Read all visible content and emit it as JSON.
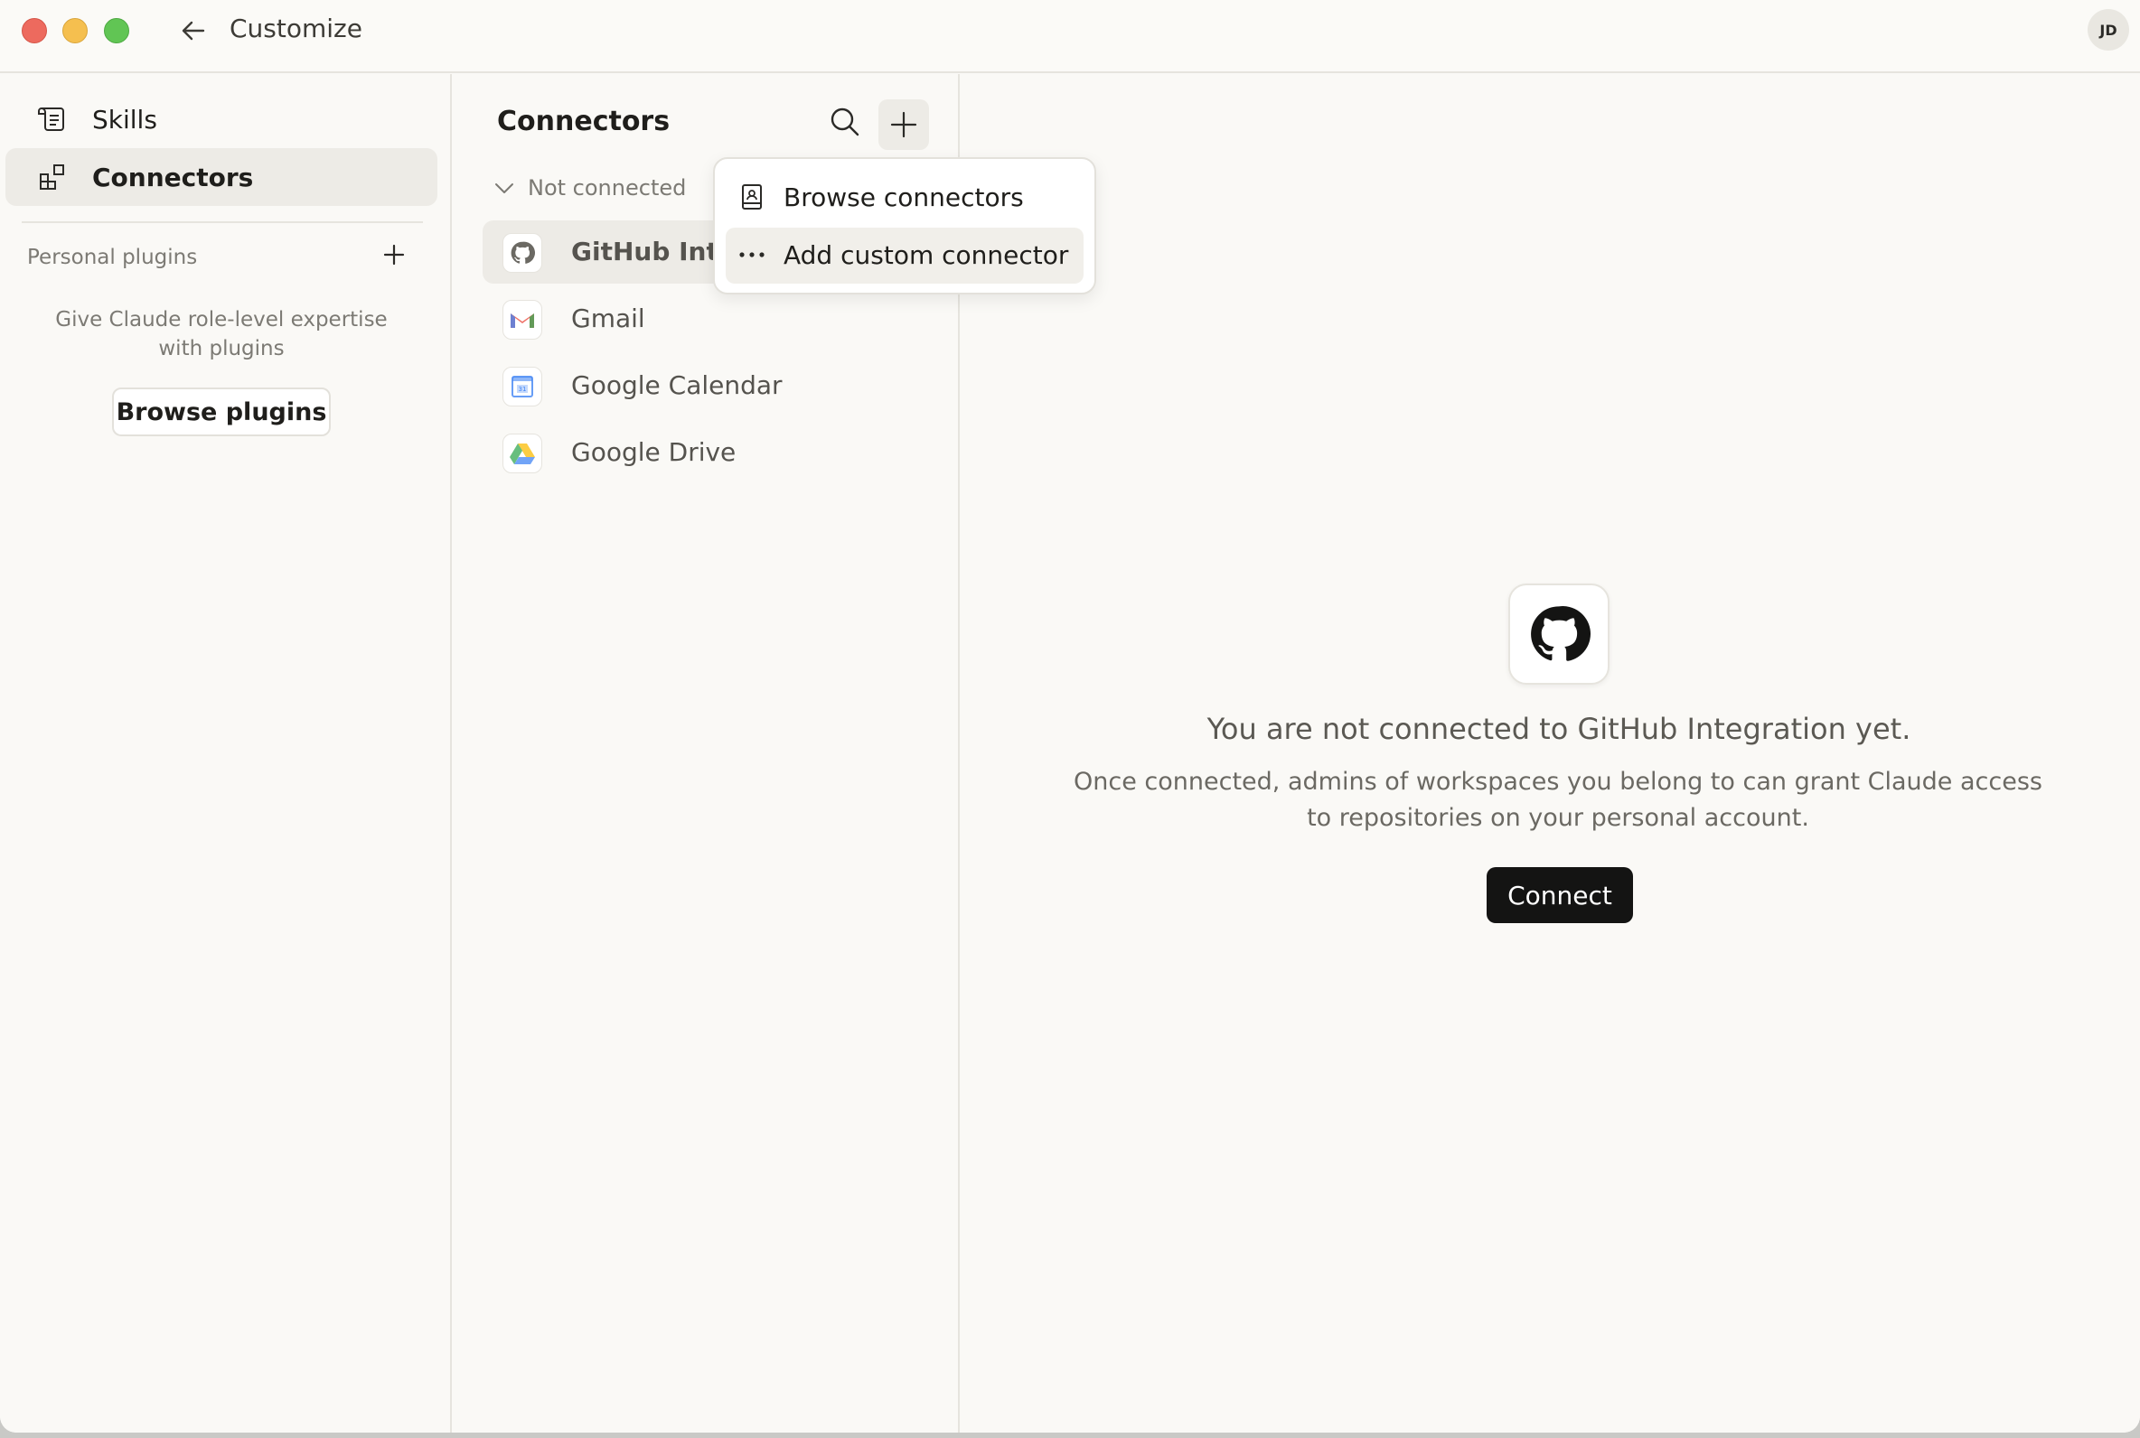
{
  "window": {
    "title": "Customize",
    "user_initials": "JD"
  },
  "sidebar": {
    "items": [
      {
        "label": "Skills",
        "icon": "scroll-icon",
        "active": false
      },
      {
        "label": "Connectors",
        "icon": "connectors-icon",
        "active": true
      }
    ],
    "section_label": "Personal plugins",
    "plugins_description": "Give Claude role-level expertise with plugins",
    "browse_plugins_label": "Browse plugins"
  },
  "connectors": {
    "title": "Connectors",
    "group_label": "Not connected",
    "items": [
      {
        "name": "GitHub Integration",
        "icon": "github-icon",
        "selected": true
      },
      {
        "name": "Gmail",
        "icon": "gmail-icon",
        "selected": false
      },
      {
        "name": "Google Calendar",
        "icon": "google-calendar-icon",
        "selected": false
      },
      {
        "name": "Google Drive",
        "icon": "google-drive-icon",
        "selected": false
      }
    ]
  },
  "menu": {
    "items": [
      {
        "label": "Browse connectors",
        "icon": "book-icon"
      },
      {
        "label": "Add custom connector",
        "icon": "ellipsis-icon"
      }
    ]
  },
  "detail": {
    "heading": "You are not connected to GitHub Integration yet.",
    "body": "Once connected, admins of workspaces you belong to can grant Claude access to repositories on your personal account.",
    "connect_label": "Connect"
  },
  "colors": {
    "background": "#faf9f6",
    "active_item": "#edebe6",
    "primary_button": "#141413"
  }
}
